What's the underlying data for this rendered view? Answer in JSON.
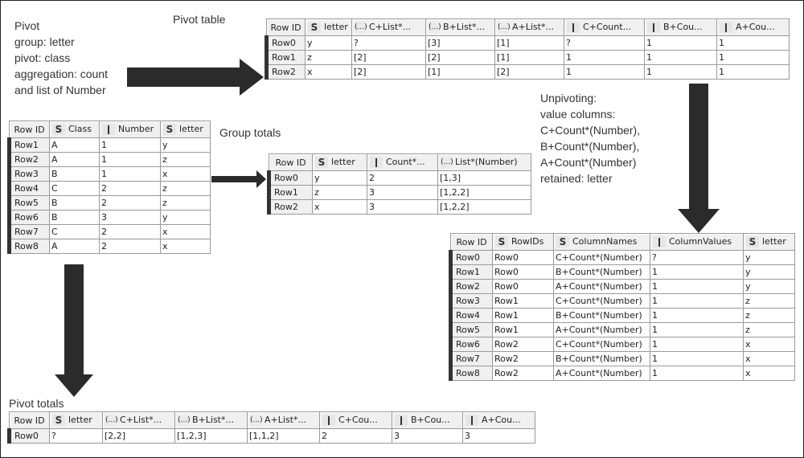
{
  "pivot_note": {
    "lines": [
      "Pivot",
      "group: letter",
      "pivot: class",
      "aggregation: count",
      "and list of Number"
    ]
  },
  "unpivot_note": {
    "lines": [
      "Unpivoting:",
      "value columns:",
      "C+Count*(Number),",
      "B+Count*(Number),",
      "A+Count*(Number)",
      "retained: letter"
    ]
  },
  "captions": {
    "pivot_table": "Pivot table",
    "group_totals": "Group totals",
    "pivot_totals": "Pivot totals"
  },
  "icons": {
    "string": "S",
    "integer": "",
    "list": "(...)"
  },
  "input_table": {
    "columns": [
      {
        "label": "Row ID",
        "type": "rowid"
      },
      {
        "label": "Class",
        "type": "string"
      },
      {
        "label": "Number",
        "type": "integer"
      },
      {
        "label": "letter",
        "type": "string"
      }
    ],
    "rows": [
      [
        "Row1",
        "A",
        "1",
        "y"
      ],
      [
        "Row2",
        "A",
        "1",
        "z"
      ],
      [
        "Row3",
        "B",
        "1",
        "x"
      ],
      [
        "Row4",
        "C",
        "2",
        "z"
      ],
      [
        "Row5",
        "B",
        "2",
        "z"
      ],
      [
        "Row6",
        "B",
        "3",
        "y"
      ],
      [
        "Row7",
        "C",
        "2",
        "x"
      ],
      [
        "Row8",
        "A",
        "2",
        "x"
      ]
    ]
  },
  "pivot_table": {
    "columns": [
      {
        "label": "Row ID",
        "type": "rowid"
      },
      {
        "label": "letter",
        "type": "string"
      },
      {
        "label": "C+List*...",
        "type": "list"
      },
      {
        "label": "B+List*...",
        "type": "list"
      },
      {
        "label": "A+List*...",
        "type": "list"
      },
      {
        "label": "C+Count...",
        "type": "integer"
      },
      {
        "label": "B+Cou...",
        "type": "integer"
      },
      {
        "label": "A+Cou...",
        "type": "integer"
      }
    ],
    "rows": [
      [
        "Row0",
        "y",
        "?",
        "[3]",
        "[1]",
        "?",
        "1",
        "1"
      ],
      [
        "Row1",
        "z",
        "[2]",
        "[2]",
        "[1]",
        "1",
        "1",
        "1"
      ],
      [
        "Row2",
        "x",
        "[2]",
        "[1]",
        "[2]",
        "1",
        "1",
        "1"
      ]
    ]
  },
  "group_totals": {
    "columns": [
      {
        "label": "Row ID",
        "type": "rowid"
      },
      {
        "label": "letter",
        "type": "string"
      },
      {
        "label": "Count*...",
        "type": "integer"
      },
      {
        "label": "List*(Number)",
        "type": "list"
      }
    ],
    "rows": [
      [
        "Row0",
        "y",
        "2",
        "[1,3]"
      ],
      [
        "Row1",
        "z",
        "3",
        "[1,2,2]"
      ],
      [
        "Row2",
        "x",
        "3",
        "[1,2,2]"
      ]
    ]
  },
  "unpivot_table": {
    "columns": [
      {
        "label": "Row ID",
        "type": "rowid"
      },
      {
        "label": "RowIDs",
        "type": "string"
      },
      {
        "label": "ColumnNames",
        "type": "string"
      },
      {
        "label": "ColumnValues",
        "type": "integer"
      },
      {
        "label": "letter",
        "type": "string"
      }
    ],
    "rows": [
      [
        "Row0",
        "Row0",
        "C+Count*(Number)",
        "?",
        "y"
      ],
      [
        "Row1",
        "Row0",
        "B+Count*(Number)",
        "1",
        "y"
      ],
      [
        "Row2",
        "Row0",
        "A+Count*(Number)",
        "1",
        "y"
      ],
      [
        "Row3",
        "Row1",
        "C+Count*(Number)",
        "1",
        "z"
      ],
      [
        "Row4",
        "Row1",
        "B+Count*(Number)",
        "1",
        "z"
      ],
      [
        "Row5",
        "Row1",
        "A+Count*(Number)",
        "1",
        "z"
      ],
      [
        "Row6",
        "Row2",
        "C+Count*(Number)",
        "1",
        "x"
      ],
      [
        "Row7",
        "Row2",
        "B+Count*(Number)",
        "1",
        "x"
      ],
      [
        "Row8",
        "Row2",
        "A+Count*(Number)",
        "1",
        "x"
      ]
    ]
  },
  "pivot_totals": {
    "columns": [
      {
        "label": "Row ID",
        "type": "rowid"
      },
      {
        "label": "letter",
        "type": "string"
      },
      {
        "label": "C+List*...",
        "type": "list"
      },
      {
        "label": "B+List*...",
        "type": "list"
      },
      {
        "label": "A+List*...",
        "type": "list"
      },
      {
        "label": "C+Cou...",
        "type": "integer"
      },
      {
        "label": "B+Cou...",
        "type": "integer"
      },
      {
        "label": "A+Cou...",
        "type": "integer"
      }
    ],
    "rows": [
      [
        "Row0",
        "?",
        "[2,2]",
        "[1,2,3]",
        "[1,1,2]",
        "2",
        "3",
        "3"
      ]
    ]
  },
  "colors": {
    "arrow": "#2b2b2b",
    "header_bg": "#f0f0f0",
    "grid": "#9a9a9a",
    "row_marker": "#333333"
  }
}
